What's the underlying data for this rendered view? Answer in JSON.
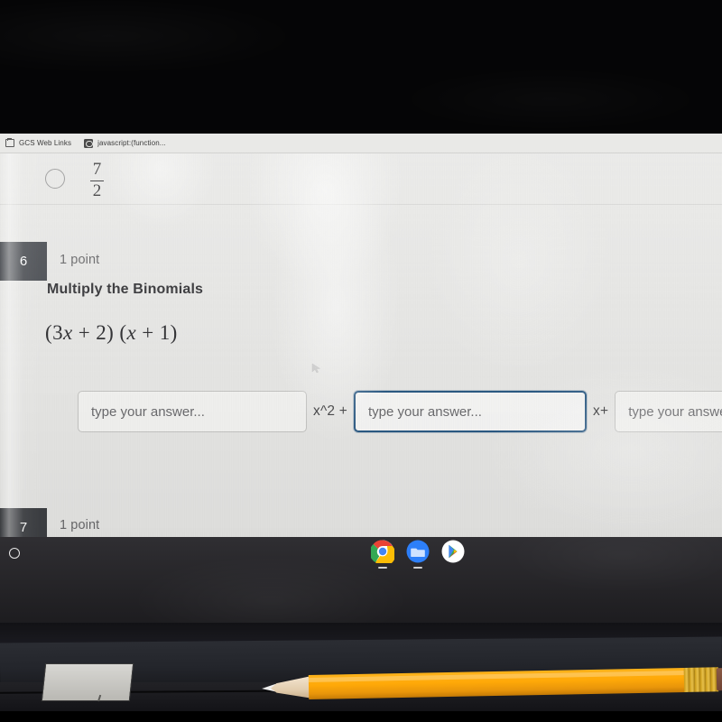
{
  "browser": {
    "bookmarks": [
      {
        "label": "GCS Web Links",
        "icon": "folder-icon"
      },
      {
        "label": "javascript:(function...",
        "icon": "script-bookmarklet-icon"
      }
    ]
  },
  "page": {
    "previous_question_remnant": {
      "radio_selected": false,
      "answer_fraction": {
        "numerator": "7",
        "denominator": "2"
      }
    },
    "questions": [
      {
        "number": "6",
        "points": "1 point",
        "prompt": "Multiply the Binomials",
        "expression_parts": {
          "open1": "(",
          "coef": "3",
          "var1": "x",
          "plus1": "+",
          "const1": "2",
          "close1": ")",
          "open2": "(",
          "var2": "x",
          "plus2": "+",
          "const2": "1",
          "close2": ")"
        },
        "expression_plain": "(3x + 2) (x + 1)",
        "answer_fields": [
          {
            "placeholder": "type your answer...",
            "value": "",
            "focused": false,
            "suffix": "x^2 +"
          },
          {
            "placeholder": "type your answer...",
            "value": "",
            "focused": true,
            "suffix": "x+"
          },
          {
            "placeholder": "type your answer...",
            "value": "",
            "focused": false,
            "suffix": ""
          }
        ]
      },
      {
        "number": "7",
        "points": "1 point",
        "prompt": "",
        "expression_plain": "",
        "answer_fields": []
      }
    ]
  },
  "shelf": {
    "launcher_label": "launcher",
    "icons": [
      {
        "name": "chrome-icon",
        "active": true
      },
      {
        "name": "files-icon",
        "active": true
      },
      {
        "name": "play-store-icon",
        "active": false
      }
    ]
  },
  "colors": {
    "focus_border": "#2c5b85",
    "badge_bg": "#4d5055",
    "page_bg": "#e9e9e7",
    "shelf_bg": "#27262a",
    "pencil_yellow": "#ffa908"
  }
}
